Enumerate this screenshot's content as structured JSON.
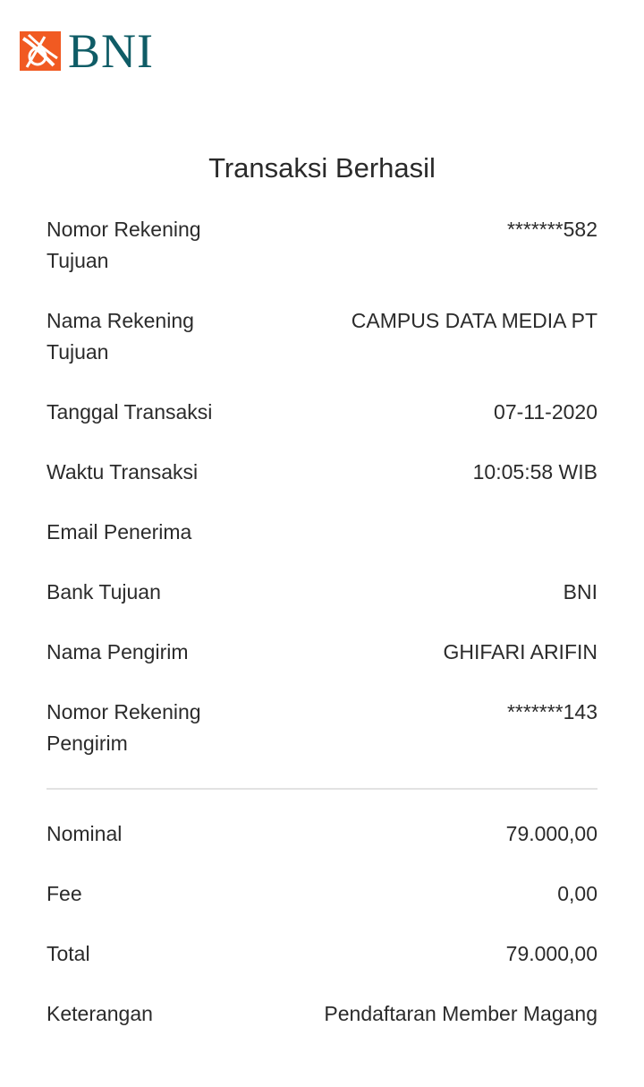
{
  "brand": {
    "name": "BNI",
    "colors": {
      "primary": "#0f5c66",
      "accent": "#f15a22"
    },
    "icon": "bni-logo-icon"
  },
  "title": "Transaksi Berhasil",
  "details": [
    {
      "label": "Nomor Rekening Tujuan",
      "value": "*******582"
    },
    {
      "label": "Nama Rekening Tujuan",
      "value": "CAMPUS DATA MEDIA PT"
    },
    {
      "label": "Tanggal Transaksi",
      "value": "07-11-2020"
    },
    {
      "label": "Waktu Transaksi",
      "value": "10:05:58 WIB"
    },
    {
      "label": "Email Penerima",
      "value": ""
    },
    {
      "label": "Bank Tujuan",
      "value": "BNI"
    },
    {
      "label": "Nama Pengirim",
      "value": "GHIFARI ARIFIN"
    },
    {
      "label": "Nomor Rekening Pengirim",
      "value": "*******143"
    }
  ],
  "summary": [
    {
      "label": "Nominal",
      "value": "79.000,00"
    },
    {
      "label": "Fee",
      "value": "0,00"
    },
    {
      "label": "Total",
      "value": "79.000,00"
    },
    {
      "label": "Keterangan",
      "value": "Pendaftaran Member Magang"
    }
  ]
}
